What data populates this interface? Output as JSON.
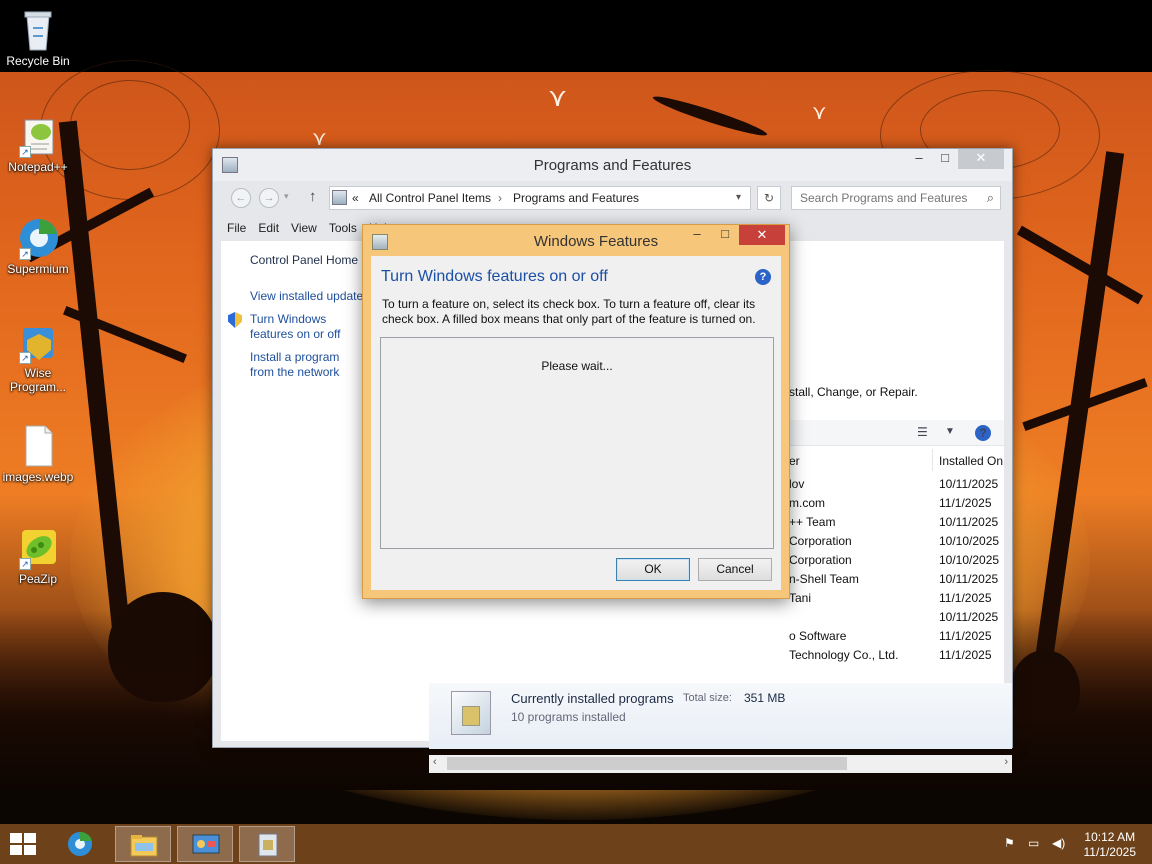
{
  "desktop": {
    "icons": [
      {
        "label": "Recycle Bin",
        "icon": "recycle-bin-icon"
      },
      {
        "label": "Notepad++",
        "icon": "notepad-plus-plus-icon"
      },
      {
        "label": "Supermium",
        "icon": "supermium-browser-icon"
      },
      {
        "label": "Wise Program...",
        "icon": "wise-program-uninstaller-icon"
      },
      {
        "label": "images.webp",
        "icon": "image-file-icon"
      },
      {
        "label": "PeaZip",
        "icon": "peazip-icon"
      }
    ]
  },
  "programs_window": {
    "title": "Programs and Features",
    "caption": {
      "minimize": "–",
      "maximize": "□",
      "close": "✕"
    },
    "address": {
      "chevron": "«",
      "crumbs": [
        "All Control Panel Items",
        "Programs and Features"
      ],
      "separator": "›"
    },
    "search": {
      "placeholder": "Search Programs and Features"
    },
    "menu": [
      "File",
      "Edit",
      "View",
      "Tools",
      "Help"
    ],
    "left_pane": {
      "home": "Control Panel Home",
      "view_updates": "View installed updates",
      "turn_features": "Turn Windows features on or off",
      "install_network": "Install a program from the network"
    },
    "description": "stall, Change, or Repair.",
    "columns": {
      "publisher": "er",
      "installed_on": "Installed On"
    },
    "rows": [
      {
        "publisher": "lov",
        "installed_on": "10/11/2025"
      },
      {
        "publisher": "m.com",
        "installed_on": "11/1/2025"
      },
      {
        "publisher": "++ Team",
        "installed_on": "10/11/2025"
      },
      {
        "publisher": "Corporation",
        "installed_on": "10/10/2025"
      },
      {
        "publisher": "Corporation",
        "installed_on": "10/10/2025"
      },
      {
        "publisher": "n-Shell Team",
        "installed_on": "10/11/2025"
      },
      {
        "publisher": "Tani",
        "installed_on": "11/1/2025"
      },
      {
        "publisher": "",
        "installed_on": "10/11/2025"
      },
      {
        "publisher": "o Software",
        "installed_on": "11/1/2025"
      },
      {
        "publisher": "Technology Co., Ltd.",
        "installed_on": "11/1/2025"
      }
    ],
    "status": {
      "title": "Currently installed programs",
      "total_label": "Total size:",
      "total_value": "351 MB",
      "count": "10 programs installed"
    }
  },
  "features_dialog": {
    "title": "Windows Features",
    "heading": "Turn Windows features on or off",
    "description": "To turn a feature on, select its check box. To turn a feature off, clear its check box. A filled box means that only part of the feature is turned on.",
    "wait_text": "Please wait...",
    "ok_label": "OK",
    "cancel_label": "Cancel",
    "caption": {
      "minimize": "–",
      "maximize": "□",
      "close": "✕"
    }
  },
  "taskbar": {
    "pinned": [
      "supermium-browser-icon",
      "file-explorer-icon",
      "control-panel-icon",
      "windows-features-icon"
    ],
    "clock_time": "10:12 AM",
    "clock_date": "11/1/2025",
    "tray_icons": [
      "action-center-flag-icon",
      "network-icon",
      "volume-icon"
    ]
  },
  "colors": {
    "accent_title_blue": "#1a4fa6",
    "dialog_frame": "#f6c67a",
    "close_red": "#c8403a",
    "taskbar": "#6d421a"
  }
}
